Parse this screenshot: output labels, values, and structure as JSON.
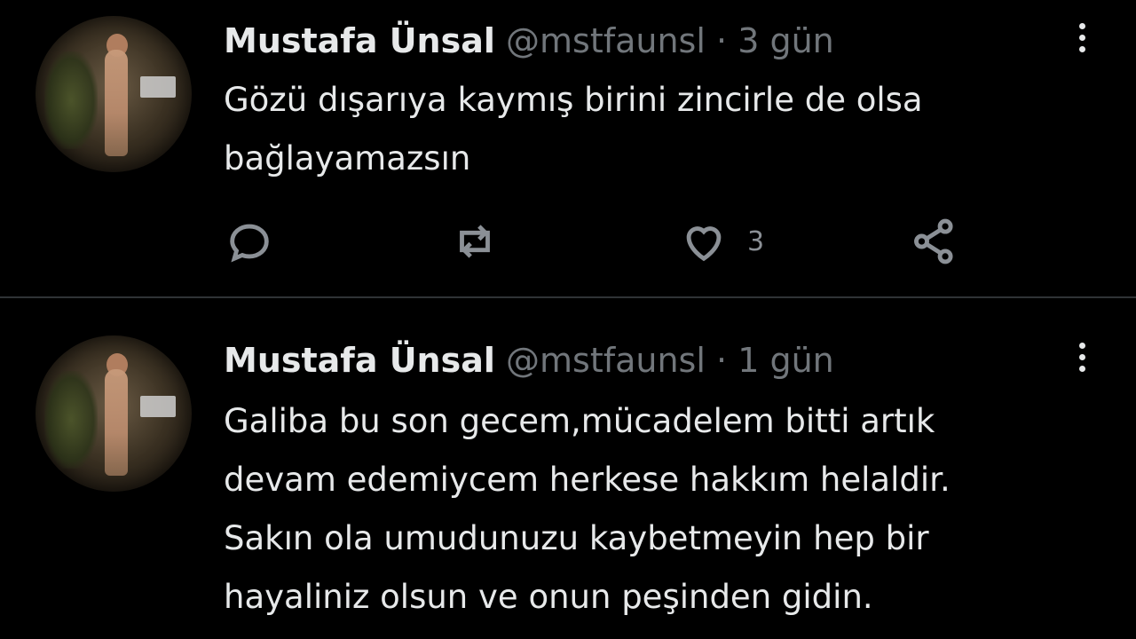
{
  "tweets": [
    {
      "name": "Mustafa Ünsal",
      "handle": "@mstfaunsl",
      "separator": "·",
      "time": "3 gün",
      "text": "Gözü dışarıya kaymış birini zincirle de olsa\nbağlayamazsın",
      "like_count": "3"
    },
    {
      "name": "Mustafa Ünsal",
      "handle": "@mstfaunsl",
      "separator": "·",
      "time": "1 gün",
      "text": "Galiba bu son gecem,mücadelem bitti artık\ndevam edemiycem herkese hakkım helaldir.\nSakın ola umudunuzu kaybetmeyin hep bir\nhayaliniz olsun ve onun peşinden gidin."
    }
  ],
  "icons": {
    "reply": "reply-icon",
    "retweet": "retweet-icon",
    "like": "heart-icon",
    "share": "share-icon",
    "more": "more-options-icon"
  },
  "colors": {
    "background": "#000000",
    "text": "#e7e9ea",
    "muted": "#71767b",
    "divider": "#2f3336"
  }
}
